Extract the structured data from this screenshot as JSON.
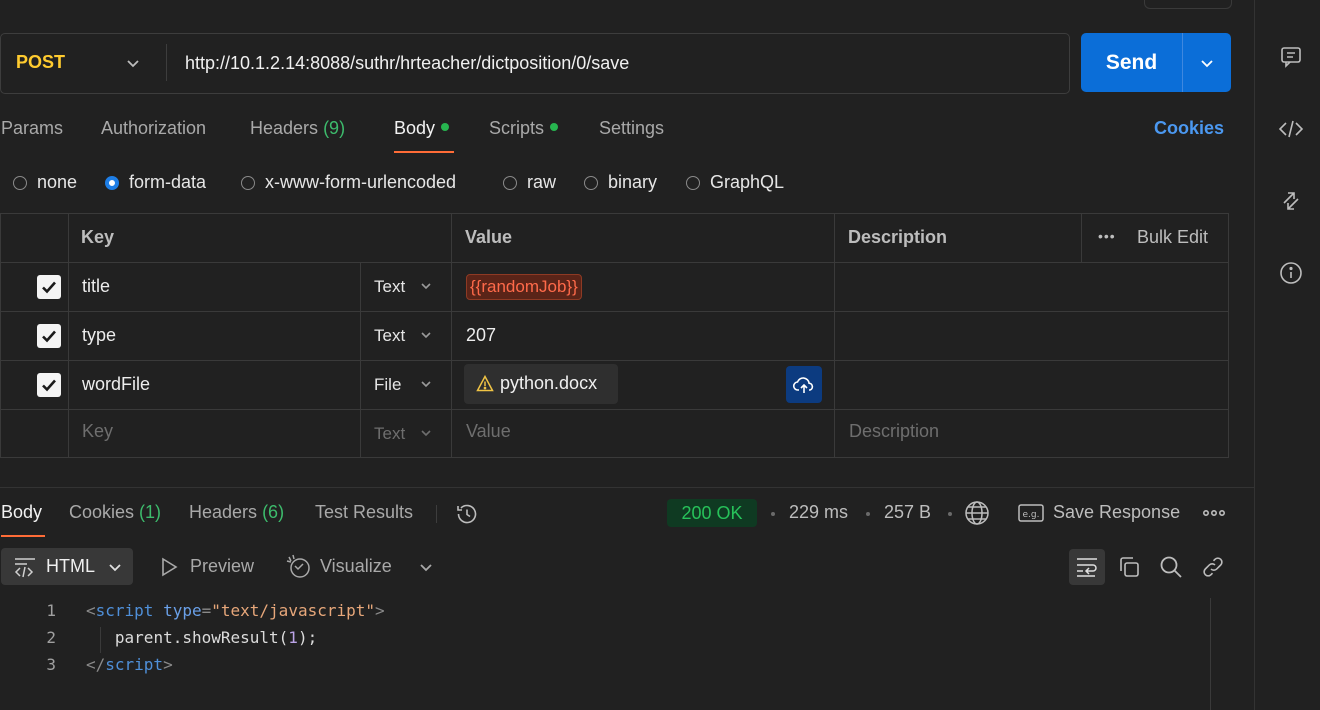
{
  "request": {
    "method": "POST",
    "url": "http://10.1.2.14:8088/suthr/hrteacher/dictposition/0/save",
    "send_label": "Send"
  },
  "tabs": [
    {
      "label": "Params"
    },
    {
      "label": "Authorization"
    },
    {
      "label": "Headers",
      "count": "(9)"
    },
    {
      "label": "Body",
      "active": true,
      "dot": true
    },
    {
      "label": "Scripts",
      "dot": true
    },
    {
      "label": "Settings"
    }
  ],
  "cookies_link": "Cookies",
  "body_modes": [
    "none",
    "form-data",
    "x-www-form-urlencoded",
    "raw",
    "binary",
    "GraphQL"
  ],
  "body_mode_selected": "form-data",
  "table": {
    "headers": {
      "key": "Key",
      "value": "Value",
      "description": "Description"
    },
    "bulk_edit": "Bulk Edit",
    "rows": [
      {
        "checked": true,
        "key": "title",
        "type": "Text",
        "value": "{{randomJob}}"
      },
      {
        "checked": true,
        "key": "type",
        "type": "Text",
        "value": "207"
      },
      {
        "checked": true,
        "key": "wordFile",
        "type": "File",
        "value": "python.docx"
      }
    ],
    "placeholder": {
      "key": "Key",
      "type": "Text",
      "value": "Value",
      "description": "Description"
    }
  },
  "response": {
    "tabs": [
      {
        "label": "Body",
        "active": true
      },
      {
        "label": "Cookies",
        "count": "(1)"
      },
      {
        "label": "Headers",
        "count": "(6)"
      },
      {
        "label": "Test Results"
      }
    ],
    "status": "200 OK",
    "time": "229 ms",
    "size": "257 B",
    "save_label": "Save Response",
    "format": "HTML",
    "preview": "Preview",
    "visualize": "Visualize",
    "code_lines": [
      "1",
      "2",
      "3"
    ],
    "code": {
      "l1_tag": "script",
      "l1_attr": "type",
      "l1_str": "\"text/javascript\"",
      "l2_call": "parent.showResult(",
      "l2_num": "1",
      "l2_end": ");",
      "l3_tag": "script"
    }
  },
  "colors": {
    "method": "#ffcb2f",
    "send": "#0b6ed8",
    "accent_tab": "#ff6c37",
    "status_ok": "#27c25a",
    "cookies_link": "#4b98f0"
  }
}
